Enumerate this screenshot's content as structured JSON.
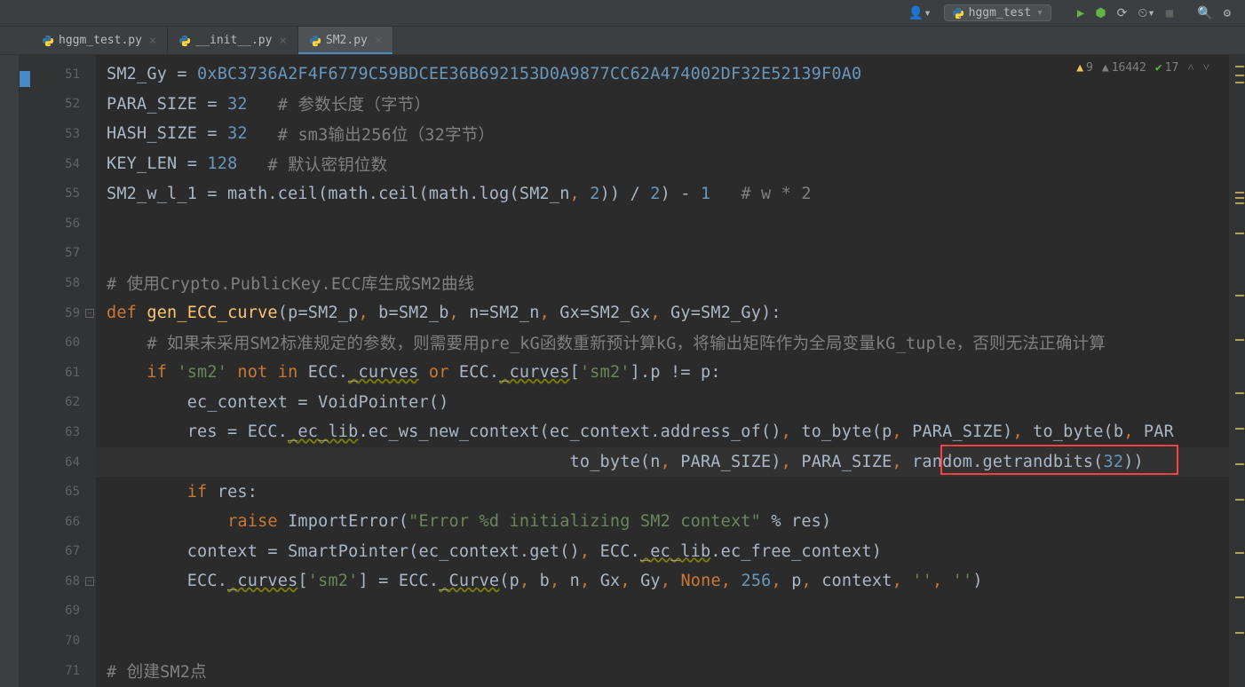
{
  "toolbar": {
    "run_config": "hggm_test"
  },
  "tabs": [
    {
      "label": "hggm_test.py",
      "active": false
    },
    {
      "label": "__init__.py",
      "active": false
    },
    {
      "label": "SM2.py",
      "active": true
    }
  ],
  "status": {
    "warnings": "9",
    "weak_warnings": "16442",
    "typos": "17"
  },
  "gutter_start": 51,
  "gutter_count": 21,
  "code": {
    "l51_a": "SM2_Gy = ",
    "l51_b": "0xBC3736A2F4F6779C59BDCEE36B692153D0A9877CC62A474002DF32E52139F0A0",
    "l52_a": "PARA_SIZE = ",
    "l52_b": "32",
    "l52_c": "   # 参数长度（字节）",
    "l53_a": "HASH_SIZE = ",
    "l53_b": "32",
    "l53_c": "   # sm3输出256位（32字节）",
    "l54_a": "KEY_LEN = ",
    "l54_b": "128",
    "l54_c": "   # 默认密钥位数",
    "l55_a": "SM2_w_l_1 = math.ceil(math.ceil(math.log(SM2_n",
    "l55_b": ", ",
    "l55_c": "2",
    "l55_d": ")) / ",
    "l55_e": "2",
    "l55_f": ") - ",
    "l55_g": "1",
    "l55_h": "   # w * 2",
    "l58": "# 使用Crypto.PublicKey.ECC库生成SM2曲线",
    "l59_a": "def ",
    "l59_b": "gen_ECC_curve",
    "l59_c": "(p=SM2_p",
    "l59_d": ", ",
    "l59_e": "b=SM2_b",
    "l59_f": ", ",
    "l59_g": "n=SM2_n",
    "l59_h": ", ",
    "l59_i": "Gx=SM2_Gx",
    "l59_j": ", ",
    "l59_k": "Gy=SM2_Gy):",
    "l60": "    # 如果未采用SM2标准规定的参数，则需要用pre_kG函数重新预计算kG，将输出矩阵作为全局变量kG_tuple，否则无法正确计算",
    "l61_a": "    ",
    "l61_b": "if ",
    "l61_c": "'sm2' ",
    "l61_d": "not in ",
    "l61_e": "ECC.",
    "l61_f": "_curves",
    "l61_g": " or ",
    "l61_h": "ECC.",
    "l61_i": "_curves",
    "l61_j": "[",
    "l61_k": "'sm2'",
    "l61_l": "].p != p:",
    "l62": "        ec_context = VoidPointer()",
    "l63_a": "        res = ",
    "l63_b": "ECC.",
    "l63_c": "_ec_lib",
    "l63_d": ".ec_ws_new_context(ec_context.address_of()",
    "l63_e": ", ",
    "l63_f": "to_byte(p",
    "l63_g": ", ",
    "l63_h": "PARA_SIZE)",
    "l63_i": ", ",
    "l63_j": "to_byte(b",
    "l63_k": ", ",
    "l63_l": "PAR",
    "l64_a": "                                              to_byte(n",
    "l64_b": ", ",
    "l64_c": "PARA_SIZE)",
    "l64_d": ", ",
    "l64_e": "PARA_SIZE",
    "l64_f": ", ",
    "l64_g": "random.getrandbits(",
    "l64_h": "32",
    "l64_i": "))",
    "l65_a": "        ",
    "l65_b": "if ",
    "l65_c": "res:",
    "l66_a": "            ",
    "l66_b": "raise ",
    "l66_c": "ImportError",
    "l66_d": "(",
    "l66_e": "\"Error %d initializing SM2 context\" ",
    "l66_f": "% res)",
    "l67_a": "        context = SmartPointer(ec_context.get()",
    "l67_b": ", ",
    "l67_c": "ECC.",
    "l67_d": "_ec_lib",
    "l67_e": ".ec_free_context)",
    "l68_a": "        ",
    "l68_b": "ECC.",
    "l68_c": "_curves",
    "l68_d": "[",
    "l68_e": "'sm2'",
    "l68_f": "] = ECC.",
    "l68_g": "_Curve",
    "l68_h": "(p",
    "l68_i": ", ",
    "l68_j": "b",
    "l68_k": ", ",
    "l68_l": "n",
    "l68_m": ", ",
    "l68_n": "Gx",
    "l68_o": ", ",
    "l68_p": "Gy",
    "l68_q": ", ",
    "l68_r": "None",
    "l68_s": ", ",
    "l68_t": "256",
    "l68_u": ", ",
    "l68_v": "p",
    "l68_w": ", ",
    "l68_x": "context",
    "l68_y": ", ",
    "l68_z": "''",
    "l68_aa": ", ",
    "l68_ab": "''",
    "l68_ac": ")",
    "l71": "# 创建SM2点"
  }
}
